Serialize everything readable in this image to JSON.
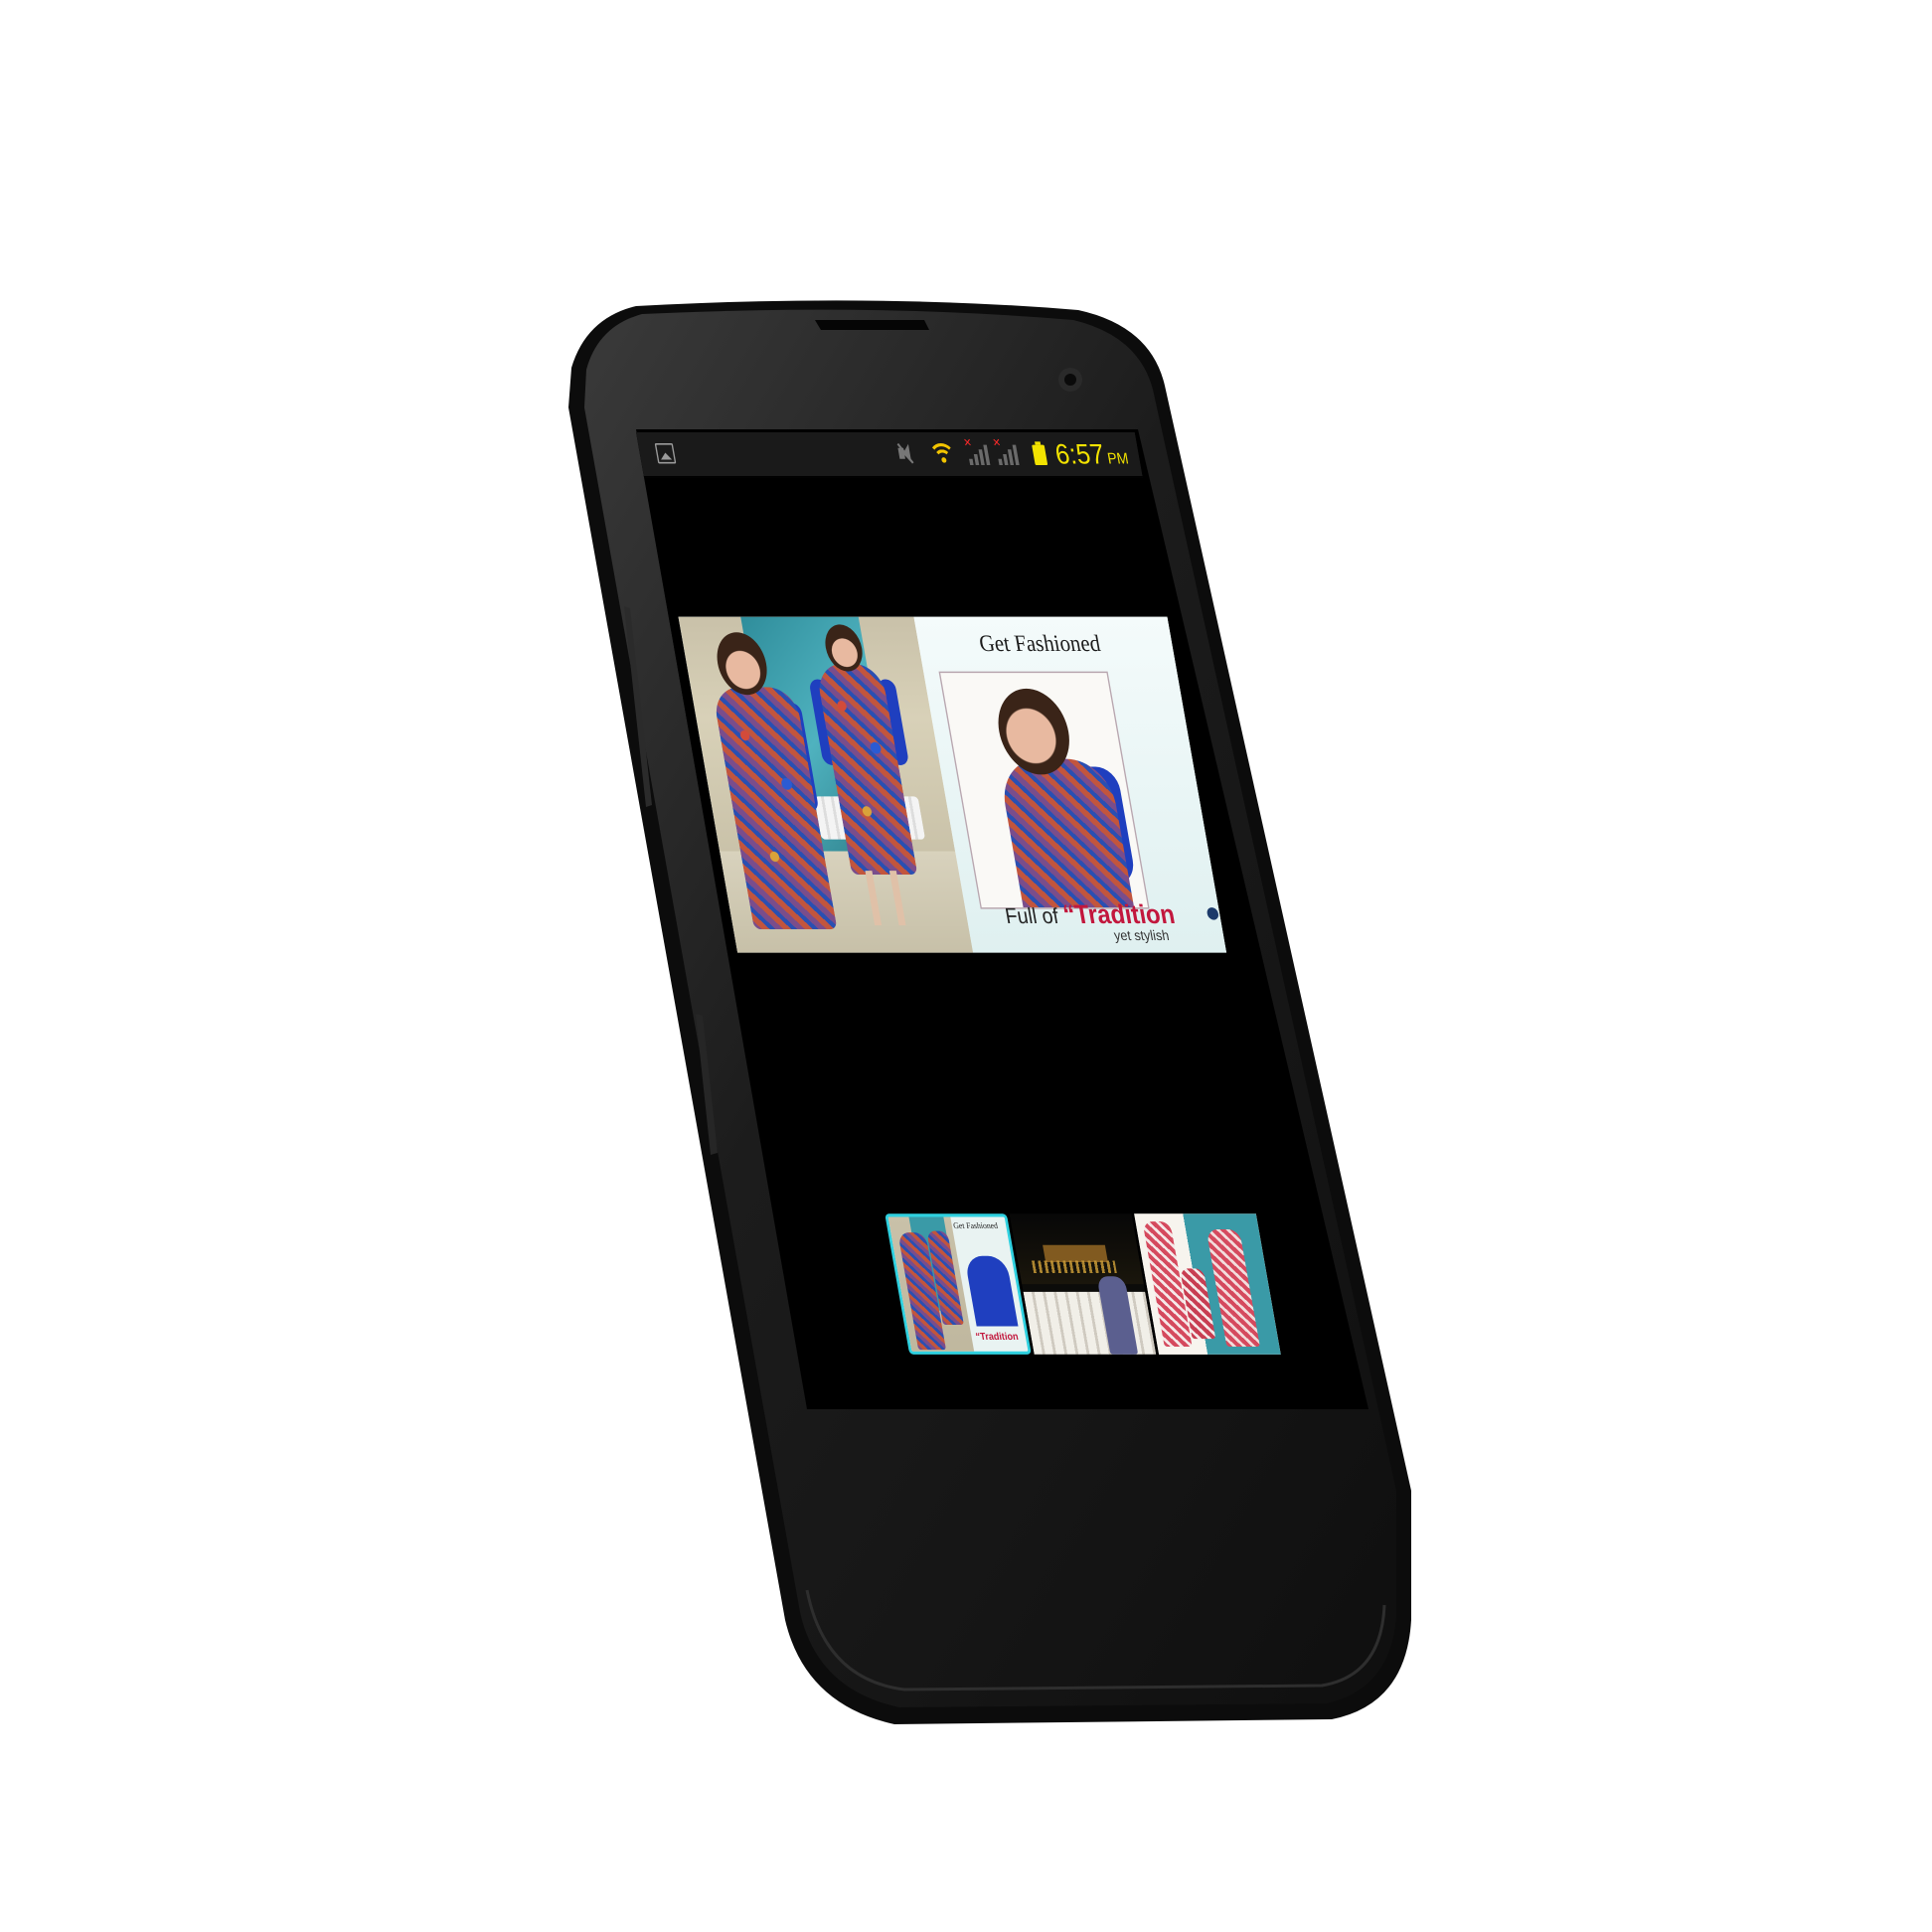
{
  "status_bar": {
    "time": "6:57",
    "ampm": "PM",
    "icons": [
      "gallery-icon",
      "mute-icon",
      "wifi-icon",
      "signal-icon",
      "signal-icon",
      "battery-icon"
    ],
    "clock_color": "#f2e200",
    "wifi_color": "#f2c400",
    "no_signal_mark_color": "#ff2a2a"
  },
  "viewer": {
    "main_image": {
      "title": "Get Fashioned",
      "tagline_prefix": "Full of",
      "tagline_strong": "“Tradition",
      "tagline_sub": "yet stylish"
    },
    "thumbnails": [
      {
        "title": "Get Fashioned",
        "tagline": "“Tradition",
        "selected": true
      },
      {
        "selected": false
      },
      {
        "selected": false
      }
    ],
    "selection_color": "#2fd1e0"
  }
}
